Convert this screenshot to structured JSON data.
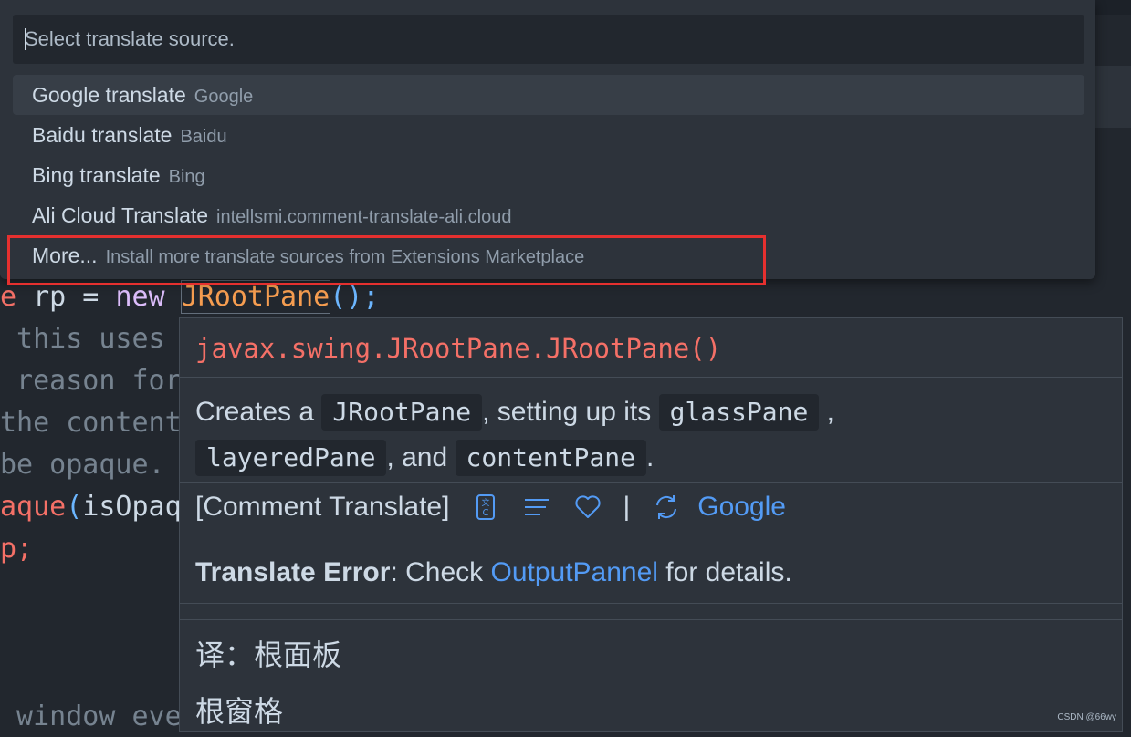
{
  "editor": {
    "code_lines": [
      {
        "parts": [
          {
            "t": "e",
            "c": "tok-kw"
          },
          {
            "t": " rp = ",
            "c": "tok-id"
          },
          {
            "t": "new",
            "c": "tok-new"
          },
          {
            "t": " ",
            "c": "tok-id"
          },
          {
            "t": "JRootPane",
            "c": "tok-cls"
          },
          {
            "t": "();",
            "c": "tok-paren"
          }
        ]
      },
      {
        "parts": [
          {
            "t": " this uses",
            "c": "tok-comment"
          }
        ]
      },
      {
        "parts": [
          {
            "t": " reason for",
            "c": "tok-comment"
          }
        ]
      },
      {
        "parts": [
          {
            "t": "the content",
            "c": "tok-comment"
          }
        ]
      },
      {
        "parts": [
          {
            "t": "be opaque.",
            "c": "tok-comment"
          }
        ]
      },
      {
        "parts": [
          {
            "t": "aque",
            "c": "tok-fn"
          },
          {
            "t": "(",
            "c": "tok-paren"
          },
          {
            "t": "isOpaq",
            "c": "tok-id"
          }
        ]
      },
      {
        "parts": [
          {
            "t": "p;",
            "c": "tok-fn"
          }
        ]
      },
      {
        "parts": [
          {
            "t": " window eve",
            "c": "tok-comment"
          }
        ]
      }
    ]
  },
  "quick_pick": {
    "placeholder": "Select translate source.",
    "items": [
      {
        "label": "Google translate",
        "description": "Google",
        "active": true
      },
      {
        "label": "Baidu translate",
        "description": "Baidu",
        "active": false
      },
      {
        "label": "Bing translate",
        "description": "Bing",
        "active": false
      },
      {
        "label": "Ali Cloud Translate",
        "description": "intellsmi.comment-translate-ali.cloud",
        "active": false
      },
      {
        "label": "More...",
        "description": "Install more translate sources from Extensions Marketplace",
        "active": false
      }
    ]
  },
  "hover": {
    "signature": "javax.swing.JRootPane.JRootPane()",
    "doc": {
      "prefix": "Creates a",
      "code1": "JRootPane",
      "mid1": ", setting up its",
      "code2": "glassPane",
      "mid2": ",",
      "code3": "layeredPane",
      "mid3": ", and",
      "code4": "contentPane",
      "suffix": "."
    },
    "actions": {
      "label": "[Comment Translate]",
      "pipe": "|",
      "source": "Google",
      "icons": [
        "translate-icon",
        "list-icon",
        "heart-icon",
        "sync-icon"
      ]
    },
    "error": {
      "title": "Translate Error",
      "text1": ": Check ",
      "link": "OutputPannel",
      "text2": " for details."
    },
    "translation_line1": "译：根面板",
    "translation_line2": "根窗格"
  },
  "watermark": "CSDN @66wy",
  "colors": {
    "accent": "#539bf5",
    "highlight_border": "#e5302f",
    "signature": "#f47067"
  }
}
